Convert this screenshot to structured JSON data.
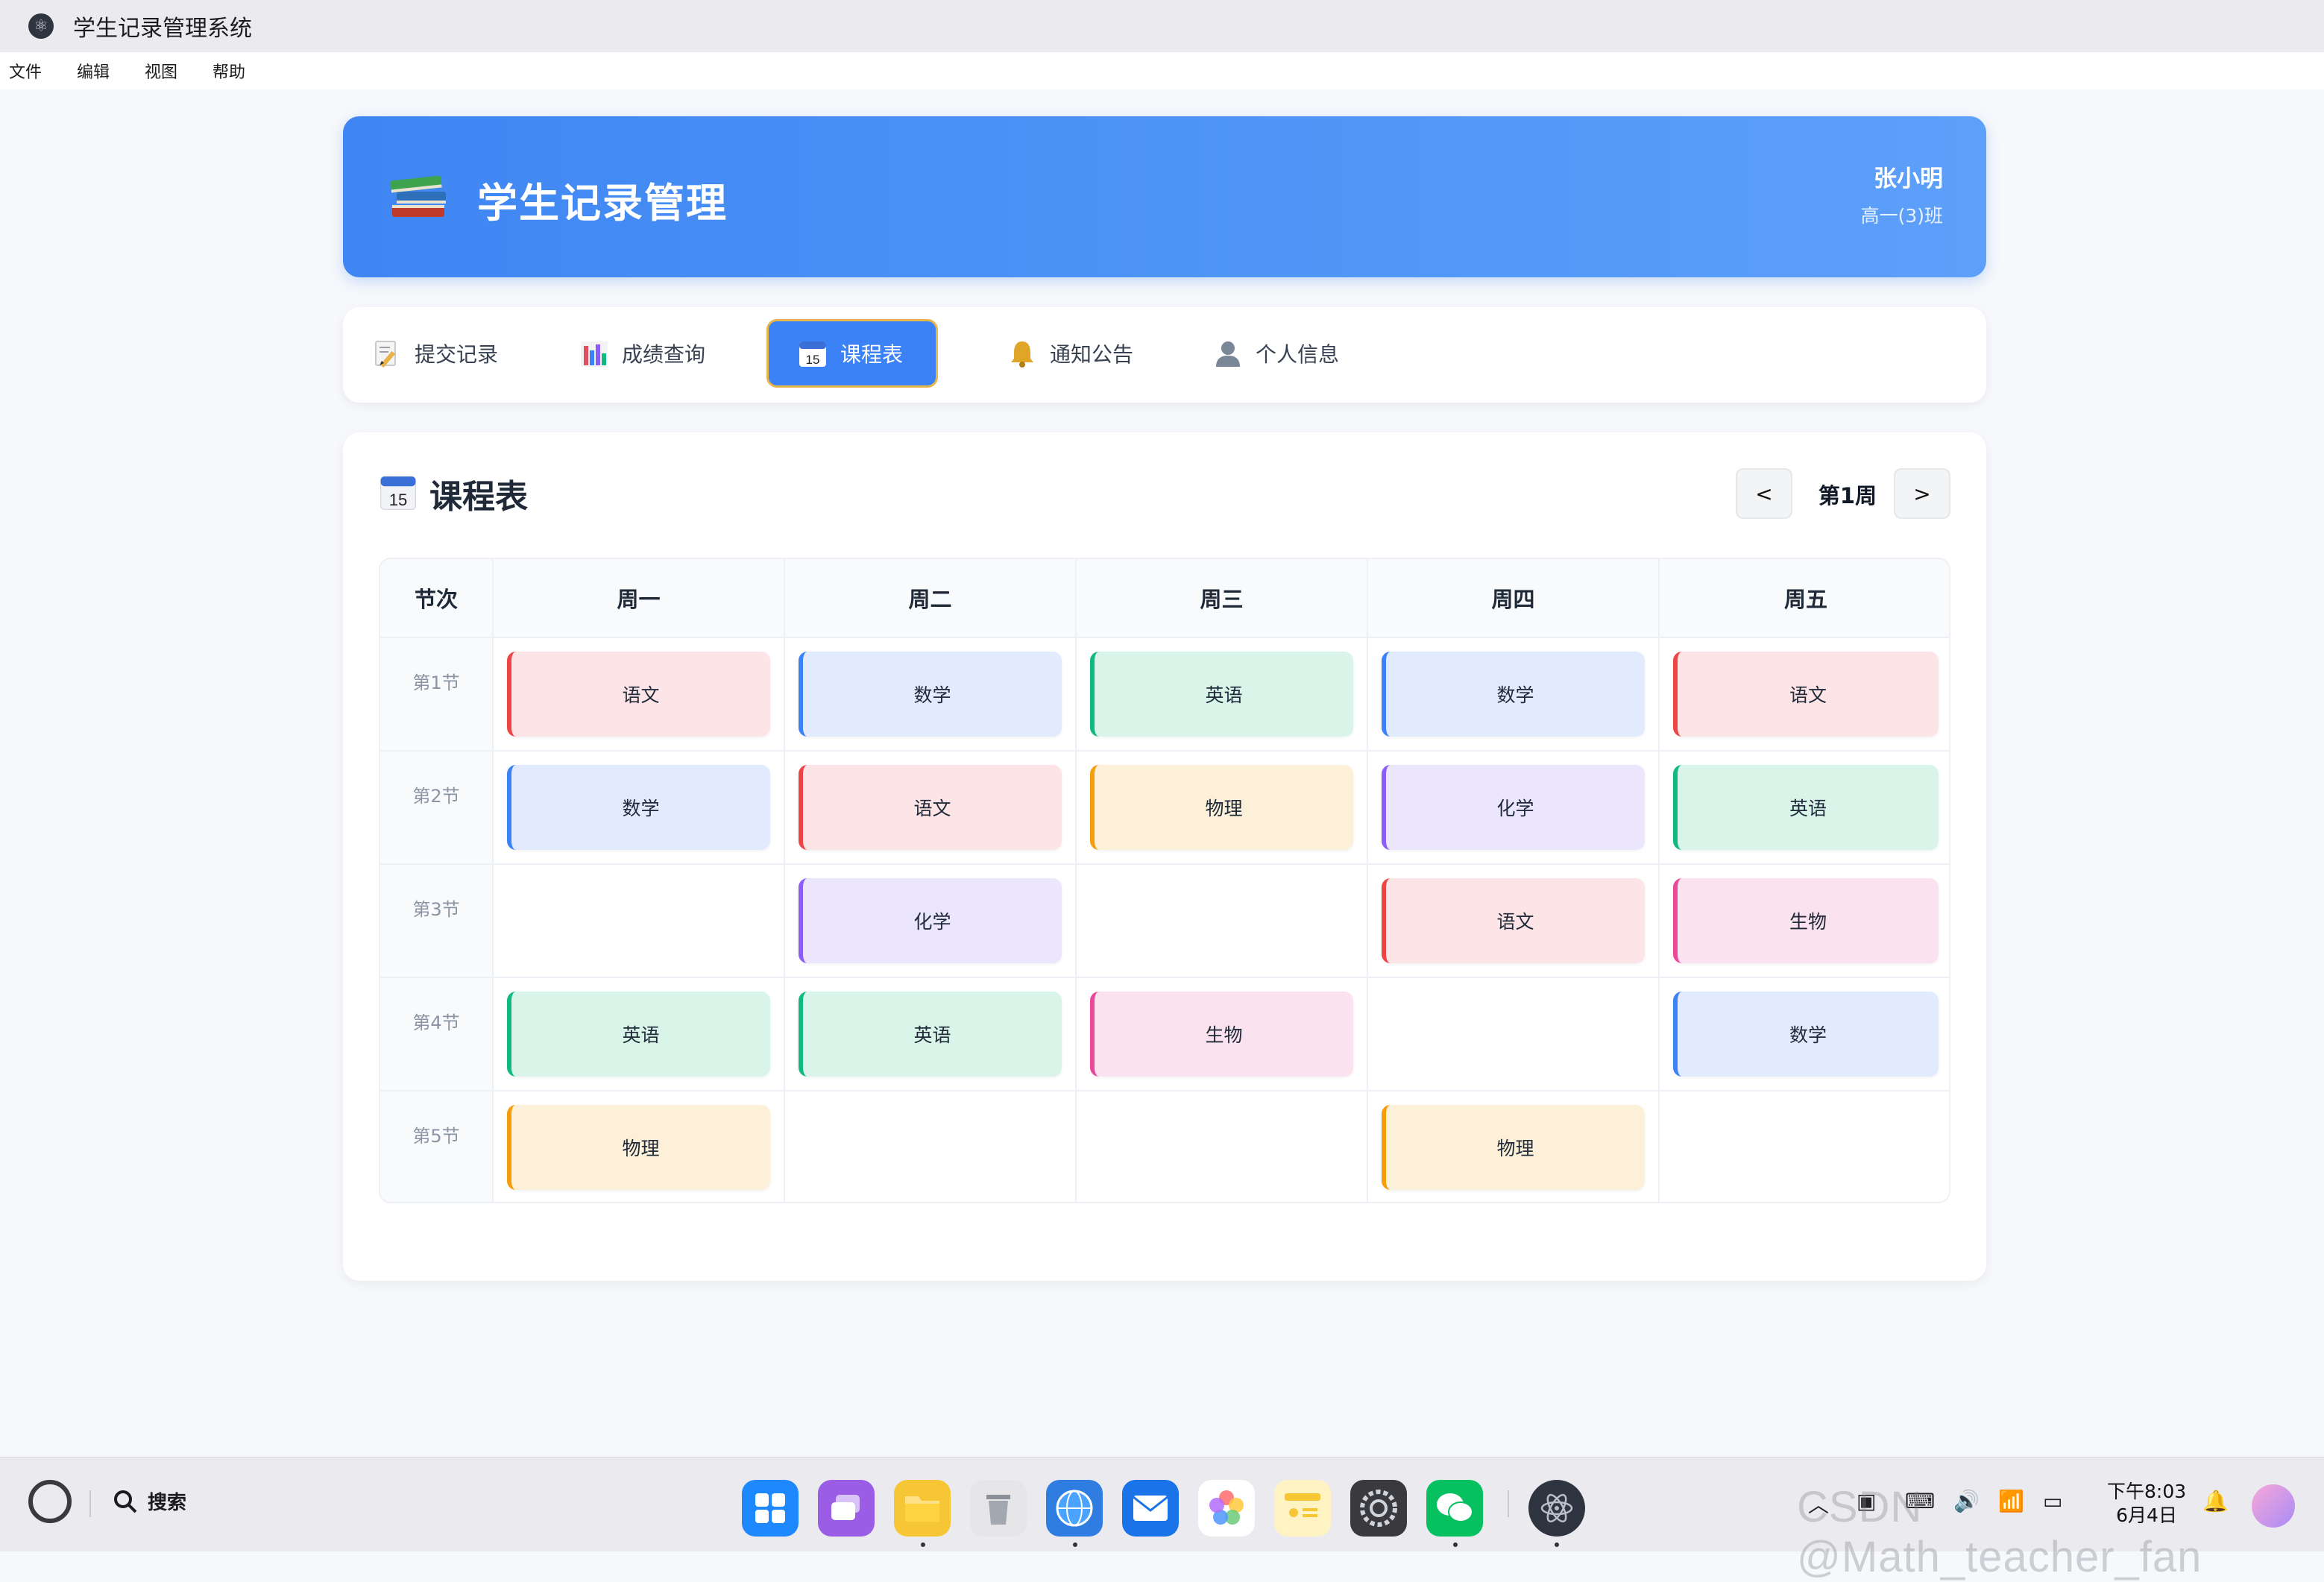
{
  "window": {
    "title": "学生记录管理系统"
  },
  "menu": [
    "文件",
    "编辑",
    "视图",
    "帮助"
  ],
  "header": {
    "title": "学生记录管理",
    "user_name": "张小明",
    "user_class": "高一(3)班"
  },
  "nav": {
    "tabs": [
      {
        "label": "提交记录",
        "icon": "memo-icon",
        "active": false
      },
      {
        "label": "成绩查询",
        "icon": "bar-chart-icon",
        "active": false
      },
      {
        "label": "课程表",
        "icon": "calendar-icon",
        "active": true
      },
      {
        "label": "通知公告",
        "icon": "bell-icon",
        "active": false
      },
      {
        "label": "个人信息",
        "icon": "user-icon",
        "active": false
      }
    ]
  },
  "schedule": {
    "title": "课程表",
    "calendar_icon_number": "15",
    "prev_label": "<",
    "next_label": ">",
    "week_label": "第1周",
    "period_header": "节次",
    "days": [
      "周一",
      "周二",
      "周三",
      "周四",
      "周五"
    ],
    "periods": [
      "第1节",
      "第2节",
      "第3节",
      "第4节",
      "第5节"
    ],
    "grid": [
      [
        "语文",
        "数学",
        "英语",
        "数学",
        "语文"
      ],
      [
        "数学",
        "语文",
        "物理",
        "化学",
        "英语"
      ],
      [
        "",
        "化学",
        "",
        "语文",
        "生物"
      ],
      [
        "英语",
        "英语",
        "生物",
        "",
        "数学"
      ],
      [
        "物理",
        "",
        "",
        "物理",
        ""
      ]
    ],
    "subject_colors": {
      "语文": {
        "bg": "#fde4e6",
        "accent": "#ef4444"
      },
      "数学": {
        "bg": "#e2ebfd",
        "accent": "#3b82f6"
      },
      "英语": {
        "bg": "#d9f5ea",
        "accent": "#10b981"
      },
      "物理": {
        "bg": "#fdf0d8",
        "accent": "#f59e0b"
      },
      "化学": {
        "bg": "#ece6fd",
        "accent": "#8b5cf6"
      },
      "生物": {
        "bg": "#fbe2ef",
        "accent": "#ec4899"
      }
    }
  },
  "taskbar": {
    "search_label": "搜索",
    "clock_time": "下午8:03",
    "clock_date": "6月4日",
    "watermark": "CSDN @Math_teacher_fan"
  },
  "colors": {
    "primary": "#3b82f6",
    "header_gradient_end": "#5da0fa",
    "active_tab_border": "#e8b64a"
  }
}
